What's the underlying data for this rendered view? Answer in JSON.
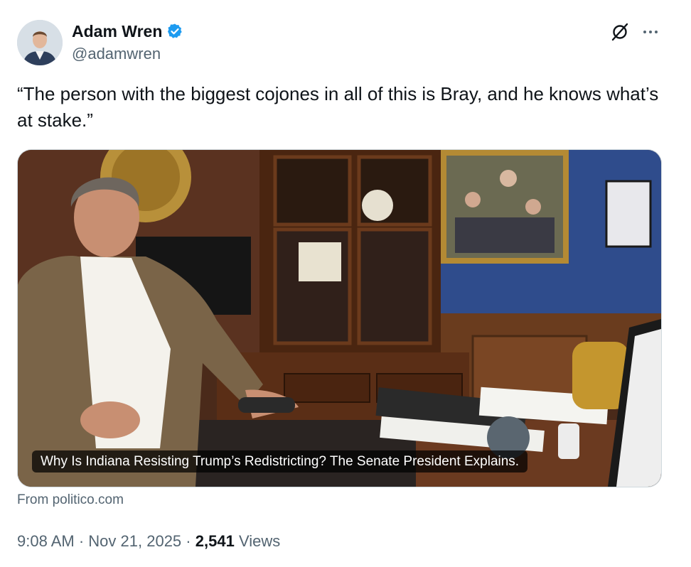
{
  "author": {
    "display_name": "Adam Wren",
    "handle": "@adamwren",
    "verified_color": "#1d9bf0"
  },
  "header_icons": [
    "grok-icon",
    "more-icon"
  ],
  "tweet": {
    "text": "“The person with the biggest cojones in all of this is Bray, and he knows what’s at stake.”"
  },
  "link_card": {
    "caption": "Why Is Indiana Resisting Trump’s Redistricting? The Senate President Explains.",
    "source": "From politico.com"
  },
  "meta": {
    "time": "9:08 AM",
    "separator": "·",
    "date": "Nov 21, 2025",
    "views_count": "2,541",
    "views_label": "Views"
  }
}
